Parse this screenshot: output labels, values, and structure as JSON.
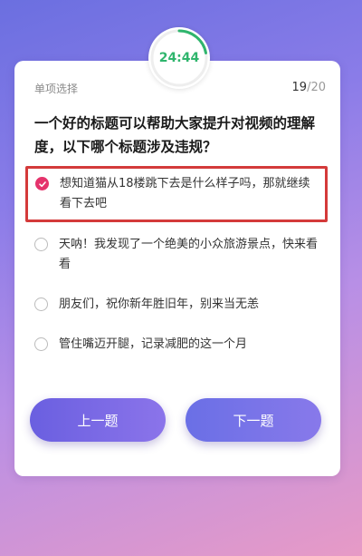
{
  "timer": {
    "text": "24:44",
    "remaining_fraction": 0.22,
    "color": "#2fb56d"
  },
  "quiz": {
    "type_label": "单项选择",
    "current": "19",
    "total": "/20",
    "question": "一个好的标题可以帮助大家提升对视频的理解度，以下哪个标题涉及违规？",
    "options": [
      {
        "text": "想知道猫从18楼跳下去是什么样子吗，那就继续看下去吧",
        "selected": true
      },
      {
        "text": "天呐！我发现了一个绝美的小众旅游景点，快来看看",
        "selected": false
      },
      {
        "text": "朋友们，祝你新年胜旧年，别来当无恙",
        "selected": false
      },
      {
        "text": "管住嘴迈开腿，记录减肥的这一个月",
        "selected": false
      }
    ]
  },
  "buttons": {
    "prev": "上一题",
    "next": "下一题"
  },
  "colors": {
    "selected_border": "#d43a3a",
    "check": "#e5336c"
  }
}
